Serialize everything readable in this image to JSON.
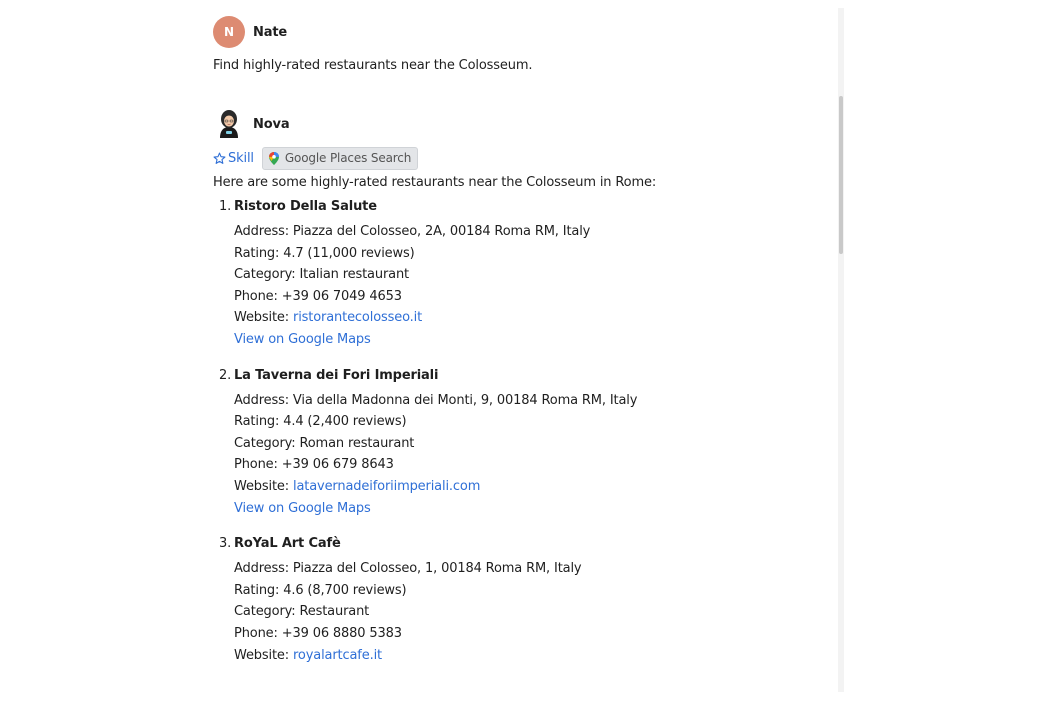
{
  "user_message": {
    "avatar_initial": "N",
    "avatar_color": "#dd8b72",
    "sender": "Nate",
    "text": "Find highly-rated restaurants near the Colosseum."
  },
  "bot_message": {
    "sender": "Nova",
    "skill_label": "Skill",
    "tool_chip": "Google Places Search",
    "intro": "Here are some highly-rated restaurants near the Colosseum in Rome:",
    "places": [
      {
        "number": "1.",
        "name": "Ristoro Della Salute",
        "address": "Address: Piazza del Colosseo, 2A, 00184 Roma RM, Italy",
        "rating": "Rating: 4.7 (11,000 reviews)",
        "category": "Category: Italian restaurant",
        "phone": "Phone: +39 06 7049 4653",
        "website_label": "Website: ",
        "website": "ristorantecolosseo.it",
        "maps_link": "View on Google Maps"
      },
      {
        "number": "2.",
        "name": "La Taverna dei Fori Imperiali",
        "address": "Address: Via della Madonna dei Monti, 9, 00184 Roma RM, Italy",
        "rating": "Rating: 4.4 (2,400 reviews)",
        "category": "Category: Roman restaurant",
        "phone": "Phone: +39 06 679 8643",
        "website_label": "Website: ",
        "website": "latavernadeiforiimperiali.com",
        "maps_link": "View on Google Maps"
      },
      {
        "number": "3.",
        "name": "RoYaL Art Cafè",
        "address": "Address: Piazza del Colosseo, 1, 00184 Roma RM, Italy",
        "rating": "Rating: 4.6 (8,700 reviews)",
        "category": "Category: Restaurant",
        "phone": "Phone: +39 06 8880 5383",
        "website_label": "Website: ",
        "website": "royalartcafe.it"
      }
    ]
  },
  "colors": {
    "link": "#2f6fd6",
    "chip_bg": "#e3e5e8"
  }
}
